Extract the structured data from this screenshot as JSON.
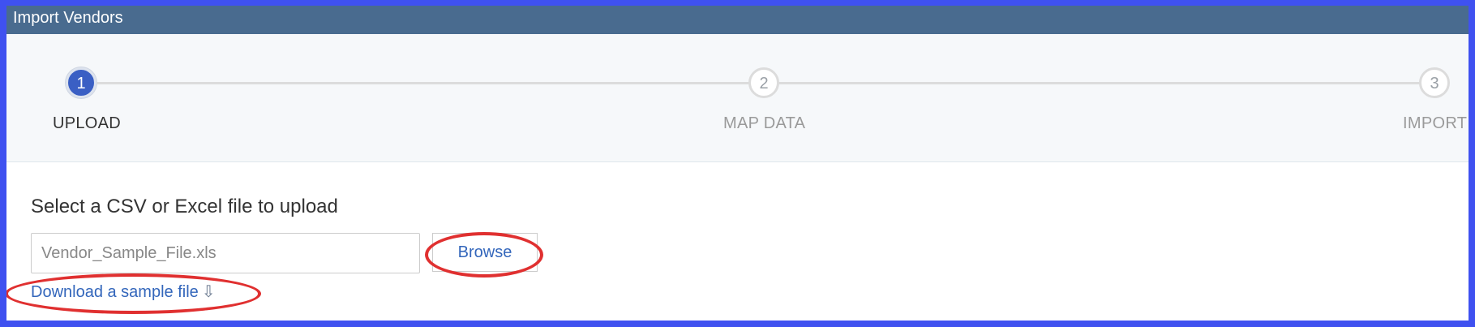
{
  "window": {
    "title": "Import Vendors"
  },
  "stepper": {
    "steps": [
      {
        "number": "1",
        "label": "UPLOAD",
        "state": "active"
      },
      {
        "number": "2",
        "label": "MAP DATA",
        "state": "inactive"
      },
      {
        "number": "3",
        "label": "IMPORT",
        "state": "inactive"
      }
    ]
  },
  "upload": {
    "heading": "Select a CSV or Excel file to upload",
    "file_placeholder": "Vendor_Sample_File.xls",
    "browse_label": "Browse",
    "download_label": "Download a sample file",
    "download_icon": "download-arrows-icon"
  },
  "colors": {
    "titlebar": "#496b8f",
    "accent": "#3a5fc4",
    "link": "#3366bb",
    "highlight": "#e03030",
    "border": "#3f51f0"
  }
}
